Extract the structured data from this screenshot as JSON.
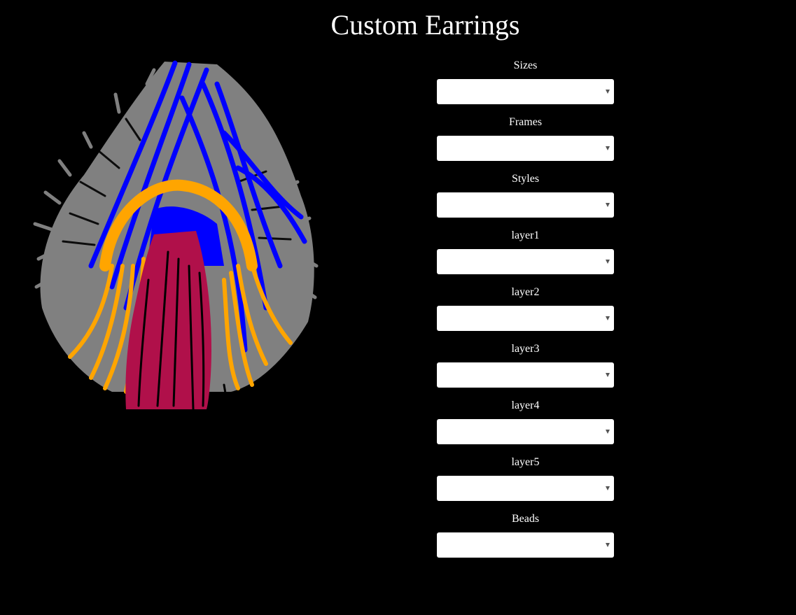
{
  "page": {
    "title": "Custom Earrings"
  },
  "colors": {
    "background": "#000000",
    "feather_gray": "#808080",
    "feather_blue": "#0000ff",
    "feather_orange": "#ffa500",
    "feather_crimson": "#b0104a"
  },
  "controls": [
    {
      "label": "Sizes",
      "value": ""
    },
    {
      "label": "Frames",
      "value": ""
    },
    {
      "label": "Styles",
      "value": ""
    },
    {
      "label": "layer1",
      "value": ""
    },
    {
      "label": "layer2",
      "value": ""
    },
    {
      "label": "layer3",
      "value": ""
    },
    {
      "label": "layer4",
      "value": ""
    },
    {
      "label": "layer5",
      "value": ""
    },
    {
      "label": "Beads",
      "value": ""
    }
  ],
  "icons": {
    "dropdown": "chevron-down-icon",
    "preview": "feather-earring-image"
  }
}
